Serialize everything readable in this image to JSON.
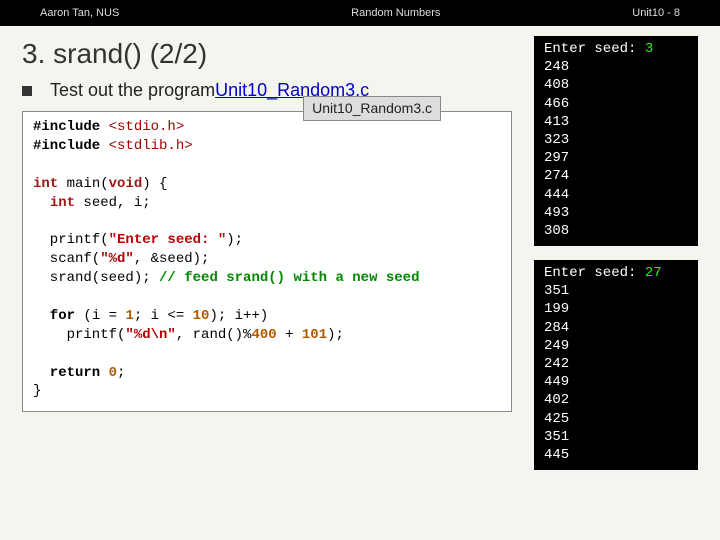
{
  "topbar": {
    "left": "Aaron Tan, NUS",
    "center": "Random Numbers",
    "right": "Unit10 - 8"
  },
  "title": "3. srand() (2/2)",
  "bullet": {
    "prefix": "Test out the program ",
    "link": "Unit10_Random3.c"
  },
  "code": {
    "file_label": "Unit10_Random3.c",
    "include_kw": "#include",
    "hdr1": "<stdio.h>",
    "hdr2": "<stdlib.h>",
    "int_ty": "int",
    "main_sig_void": "void",
    "main_sig_rest": " main(",
    "main_sig_close": ") {",
    "decl_rest": " seed, i;",
    "printf_open": "  printf(",
    "prompt_str": "\"Enter seed: \"",
    "printf_close": ");",
    "scanf_open": "  scanf(",
    "scanf_fmt": "\"%d\"",
    "scanf_rest": ", &seed);",
    "srand_line": "  srand(seed); ",
    "srand_comment": "// feed srand() with a new seed",
    "for_kw": "  for",
    "for_open": " (i = ",
    "num1a": "1",
    "for_mid1": "; i <= ",
    "num10": "10",
    "for_mid2": "); i++)",
    "printf2_open": "    printf(",
    "printf2_fmt": "\"%d\\n\"",
    "printf2_mid": ", rand()%",
    "num400": "400",
    "printf2_mid2": " + ",
    "num101": "101",
    "printf2_close": ");",
    "return_kw": "  return",
    "return_num": "0",
    "return_close": ";",
    "brace_close": "}"
  },
  "run1": {
    "prompt": "Enter seed: ",
    "seed": "3",
    "out": [
      "248",
      "408",
      "466",
      "413",
      "323",
      "297",
      "274",
      "444",
      "493",
      "308"
    ]
  },
  "run2": {
    "prompt": "Enter seed: ",
    "seed": "27",
    "out": [
      "351",
      "199",
      "284",
      "249",
      "242",
      "449",
      "402",
      "425",
      "351",
      "445"
    ]
  }
}
